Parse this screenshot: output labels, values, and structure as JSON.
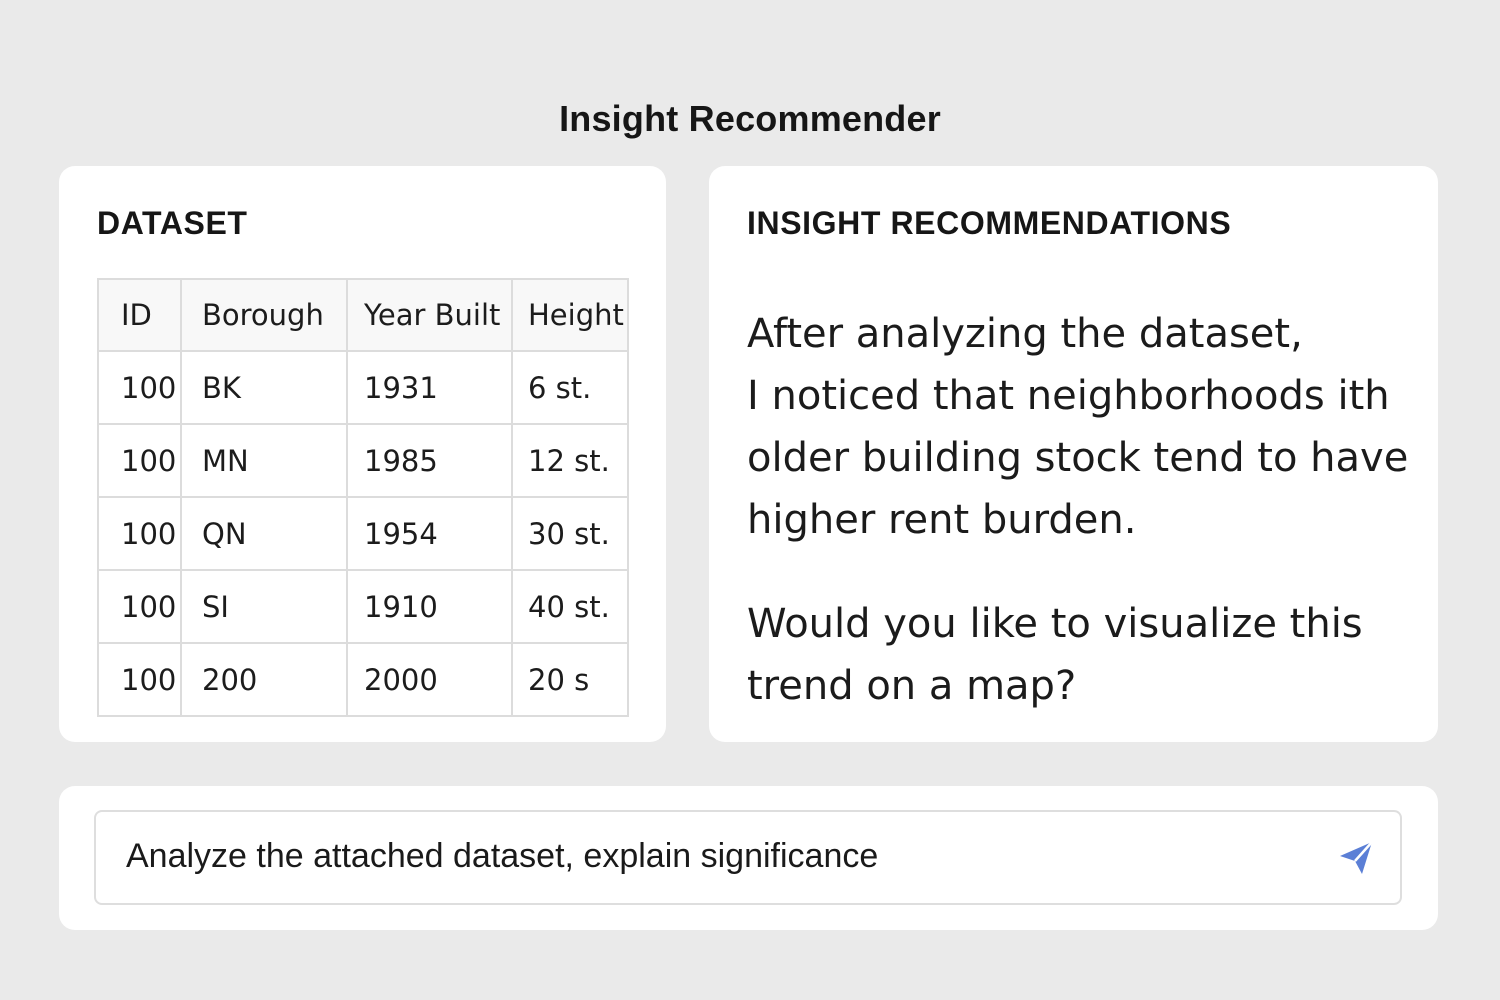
{
  "app": {
    "title": "Insight Recommender"
  },
  "dataset_panel": {
    "heading": "DATASET",
    "columns": [
      "ID",
      "Borough",
      "Year Built",
      "Height"
    ],
    "rows": [
      [
        "100",
        "BK",
        "1931",
        "6 st."
      ],
      [
        "100",
        "MN",
        "1985",
        "12 st."
      ],
      [
        "100",
        "QN",
        "1954",
        "30 st."
      ],
      [
        "100",
        "SI",
        "1910",
        "40 st."
      ],
      [
        "100",
        "200",
        "2000",
        "20 s"
      ]
    ]
  },
  "insight_panel": {
    "heading": "INSIGHT RECOMMENDATIONS",
    "paragraph_1": [
      "After analyzing the dataset,",
      "I noticed that neighborhoods ith",
      "older building stock tend to have",
      "higher rent burden."
    ],
    "paragraph_2": [
      "Would you like to visualize this",
      "trend on a map?"
    ]
  },
  "chat_input": {
    "value": "Analyze the attached dataset, explain significance",
    "send_icon": "paper-plane-icon",
    "send_icon_color": "#5b7fd6"
  }
}
